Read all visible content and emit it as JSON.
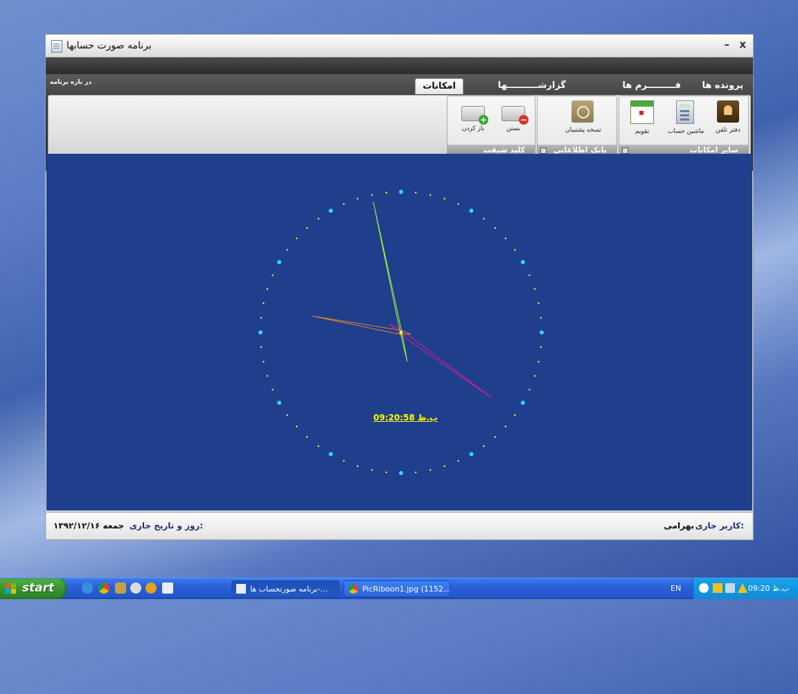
{
  "window": {
    "title": "برنامه صورت حسابها",
    "minimize_label": "–",
    "close_label": "x"
  },
  "ribbon": {
    "about_label": "در باره برنامه",
    "tabs": [
      {
        "label": "پرونده ها",
        "active": false
      },
      {
        "label": "فـــــــــرم ها",
        "active": false
      },
      {
        "label": "گزارشــــــــــها",
        "active": false
      },
      {
        "label": "امکانات",
        "active": true
      }
    ],
    "groups": {
      "other_features": {
        "label": "سایر امکانات",
        "buttons": [
          {
            "label": "دفتر تلفن",
            "icon": "phonebook-icon"
          },
          {
            "label": "ماشین حساب",
            "icon": "calculator-icon"
          },
          {
            "label": "تقویم",
            "icon": "calendar-icon"
          }
        ]
      },
      "database": {
        "label": "بانک اطلاعاتی",
        "buttons": [
          {
            "label": "نسخه پشتیبان",
            "icon": "backup-icon"
          }
        ]
      },
      "shift_key": {
        "label": "کلید شیفت",
        "buttons": [
          {
            "label": "بستن",
            "icon": "keyboard-lock-icon"
          },
          {
            "label": "باز کردن",
            "icon": "keyboard-unlock-icon"
          }
        ]
      }
    }
  },
  "clock": {
    "digital_time": "ب.ظ 09:20:58",
    "hour": 9,
    "minute": 20,
    "second": 58,
    "colors": {
      "background": "#1f3e8c",
      "major_dot": "#33d4ff",
      "minor_dot": "#ffff33",
      "hour_hand": "#e8892a",
      "minute_hand": "#e61a8f",
      "second_hand": "#99ff33",
      "digital": "#ffff00"
    }
  },
  "status": {
    "user_label": "کاربر جاری:",
    "user_value": "بهرامی",
    "date_label": "روز و تاریخ جاری:",
    "date_value": "جمعه ۱۳۹۲/۱۲/۱۶"
  },
  "taskbar": {
    "start_label": "start",
    "tasks": [
      {
        "label": "برنامه صورتحساب ها-...",
        "active": true
      },
      {
        "label": "PicRiboon1.jpg (1152...",
        "active": false
      }
    ],
    "language": "EN",
    "time": "09:20 ب.ظ",
    "quicklaunch": [
      "internet-explorer-icon",
      "chrome-icon",
      "tool-icon",
      "media-icon",
      "player-icon",
      "document-icon"
    ]
  }
}
